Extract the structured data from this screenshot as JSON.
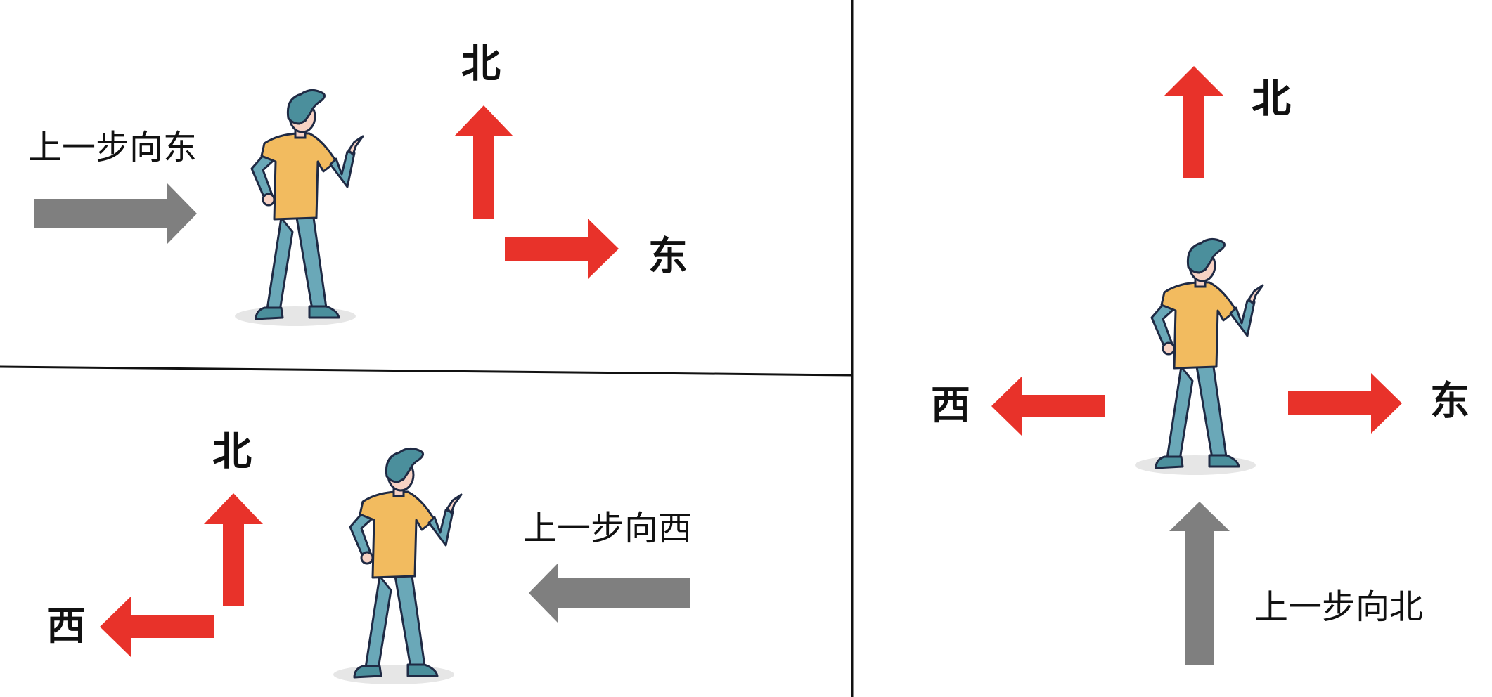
{
  "colors": {
    "current_arrow": "#e8322a",
    "previous_arrow": "#7f7f7f",
    "shirt": "#f2bb5f",
    "pants": "#6aa8b8",
    "hair": "#4b8f9c",
    "skin": "#f7d2c4",
    "outline": "#1f2a44",
    "shadow": "#e6e6e6",
    "divider": "#111111"
  },
  "icons": [
    "standing-person-pointing-icon",
    "arrow-right-icon",
    "arrow-left-icon",
    "arrow-up-icon"
  ],
  "panels": {
    "top_left": {
      "previous_step": "上一步向东",
      "north": "北",
      "east": "东"
    },
    "bottom_left": {
      "previous_step": "上一步向西",
      "north": "北",
      "west": "西"
    },
    "right": {
      "previous_step": "上一步向北",
      "north": "北",
      "west": "西",
      "east": "东"
    }
  }
}
